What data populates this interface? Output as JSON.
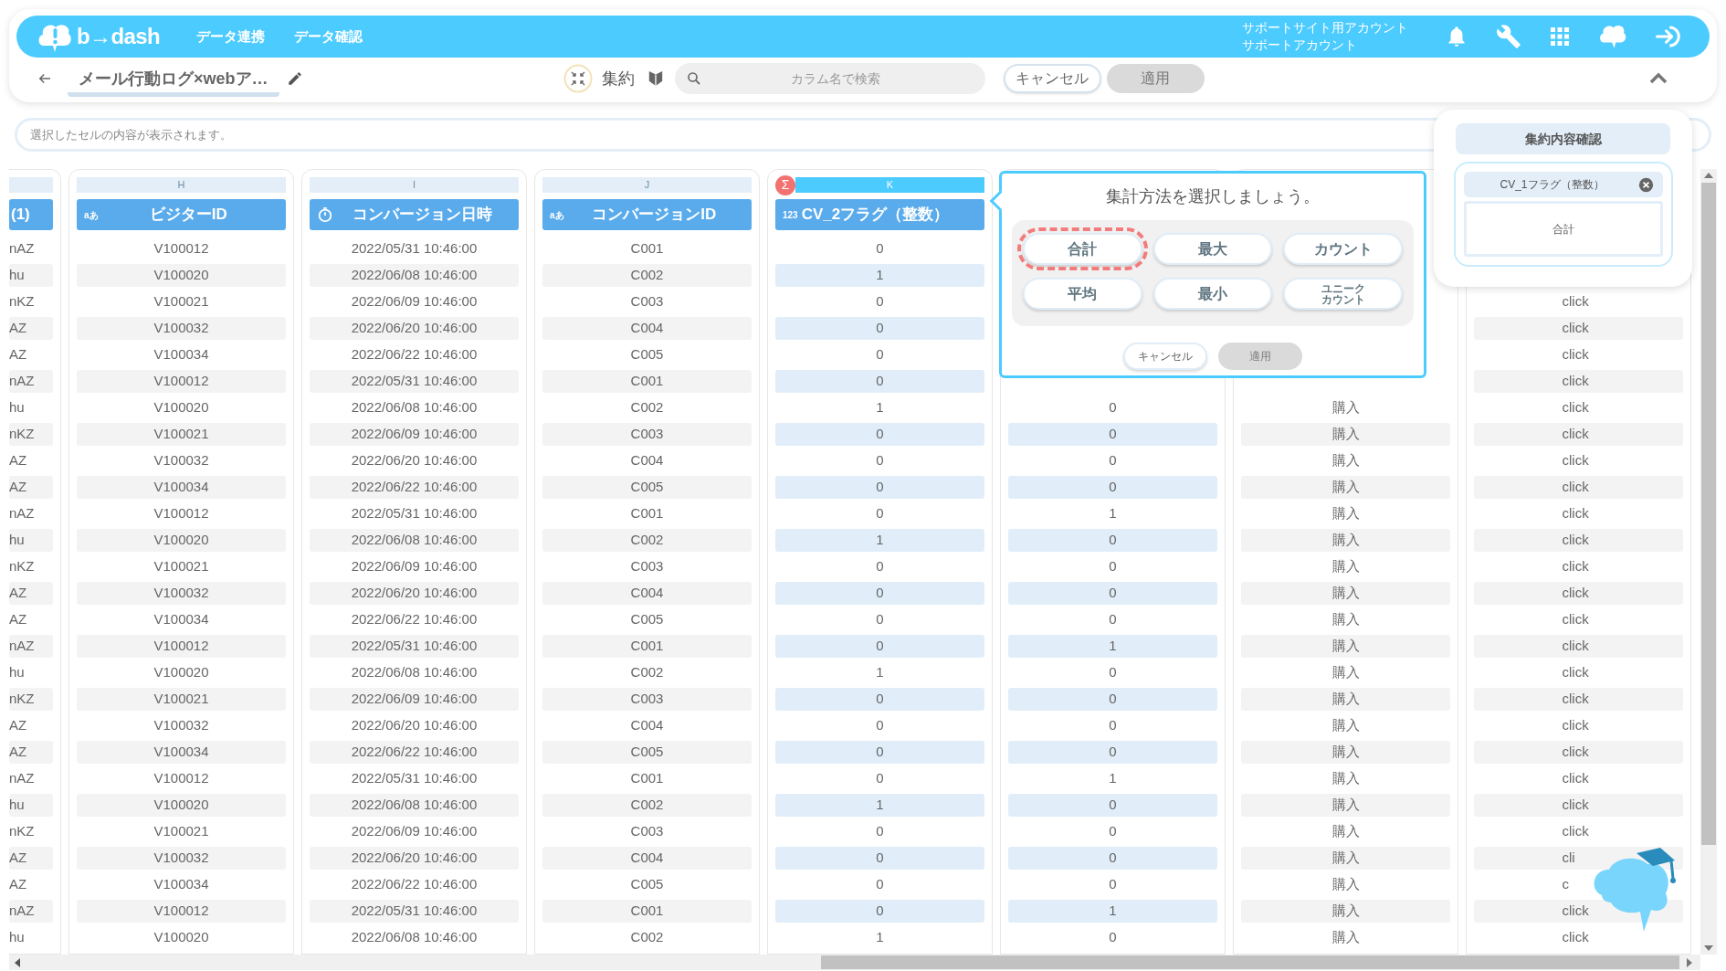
{
  "header": {
    "logo": "b→dash",
    "nav": [
      {
        "label": "データ連携"
      },
      {
        "label": "データ確認"
      }
    ],
    "account": [
      "サポートサイト用アカウント",
      "サポートアカウント"
    ]
  },
  "toolbar": {
    "title": "メール行動ログ×webア…",
    "mode_label": "集約",
    "search": {
      "placeholder": "カラム名で検索"
    },
    "buttons": [
      {
        "label": "キャンセル",
        "disabled": false
      },
      {
        "label": "適用",
        "disabled": true
      }
    ]
  },
  "cell_viewer": {
    "placeholder": "選択したセルの内容が表示されます。"
  },
  "columns": [
    {
      "title": "(1)",
      "kind": "plain",
      "selected": false,
      "aggregated": false,
      "cells": [
        "nAZ",
        "hu",
        "nKZ",
        "AZ",
        "AZ",
        "nAZ",
        "hu",
        "nKZ",
        "AZ",
        "AZ",
        "nAZ",
        "hu",
        "nKZ",
        "AZ",
        "AZ",
        "nAZ",
        "hu",
        "nKZ",
        "AZ",
        "AZ",
        "nAZ",
        "hu",
        "nKZ",
        "AZ",
        "AZ",
        "nAZ",
        "hu"
      ]
    },
    {
      "letter": "H",
      "title": "ビジターID",
      "kind": "text",
      "type_label": "aあ",
      "selected": false,
      "aggregated": false,
      "cells": [
        "V100012",
        "V100020",
        "V100021",
        "V100032",
        "V100034",
        "V100012",
        "V100020",
        "V100021",
        "V100032",
        "V100034",
        "V100012",
        "V100020",
        "V100021",
        "V100032",
        "V100034",
        "V100012",
        "V100020",
        "V100021",
        "V100032",
        "V100034",
        "V100012",
        "V100020",
        "V100021",
        "V100032",
        "V100034",
        "V100012",
        "V100020"
      ]
    },
    {
      "letter": "I",
      "title": "コンバージョン日時",
      "kind": "datetime",
      "selected": false,
      "aggregated": false,
      "cells": [
        "2022/05/31 10:46:00",
        "2022/06/08 10:46:00",
        "2022/06/09 10:46:00",
        "2022/06/20 10:46:00",
        "2022/06/22 10:46:00",
        "2022/05/31 10:46:00",
        "2022/06/08 10:46:00",
        "2022/06/09 10:46:00",
        "2022/06/20 10:46:00",
        "2022/06/22 10:46:00",
        "2022/05/31 10:46:00",
        "2022/06/08 10:46:00",
        "2022/06/09 10:46:00",
        "2022/06/20 10:46:00",
        "2022/06/22 10:46:00",
        "2022/05/31 10:46:00",
        "2022/06/08 10:46:00",
        "2022/06/09 10:46:00",
        "2022/06/20 10:46:00",
        "2022/06/22 10:46:00",
        "2022/05/31 10:46:00",
        "2022/06/08 10:46:00",
        "2022/06/09 10:46:00",
        "2022/06/20 10:46:00",
        "2022/06/22 10:46:00",
        "2022/05/31 10:46:00",
        "2022/06/08 10:46:00"
      ]
    },
    {
      "letter": "J",
      "title": "コンバージョンID",
      "kind": "text",
      "type_label": "aあ",
      "selected": false,
      "aggregated": false,
      "cells": [
        "C001",
        "C002",
        "C003",
        "C004",
        "C005",
        "C001",
        "C002",
        "C003",
        "C004",
        "C005",
        "C001",
        "C002",
        "C003",
        "C004",
        "C005",
        "C001",
        "C002",
        "C003",
        "C004",
        "C005",
        "C001",
        "C002",
        "C003",
        "C004",
        "C005",
        "C001",
        "C002"
      ]
    },
    {
      "letter": "K",
      "title": "CV_2フラグ（整数）",
      "kind": "number",
      "type_label": "123",
      "badge": "Σ",
      "selected": true,
      "aggregated": true,
      "cells": [
        "0",
        "1",
        "0",
        "0",
        "0",
        "0",
        "1",
        "0",
        "0",
        "0",
        "0",
        "1",
        "0",
        "0",
        "0",
        "0",
        "1",
        "0",
        "0",
        "0",
        "0",
        "1",
        "0",
        "0",
        "0",
        "0",
        "1"
      ]
    },
    {
      "aggregated": true,
      "cells": [
        "0",
        "0",
        "0",
        "0",
        "1",
        "0",
        "0",
        "0",
        "0",
        "1",
        "0",
        "0",
        "0",
        "0",
        "1",
        "0",
        "0",
        "0",
        "0",
        "1",
        "0"
      ]
    },
    {
      "aggregated": false,
      "cells": [
        "購入",
        "購入",
        "購入",
        "購入",
        "購入",
        "購入",
        "購入",
        "購入",
        "購入",
        "購入",
        "購入",
        "購入",
        "購入",
        "購入",
        "購入",
        "購入",
        "購入",
        "購入",
        "購入",
        "購入",
        "購入"
      ]
    },
    {
      "aggregated": false,
      "cells": [
        "click",
        "click",
        "click",
        "click",
        "click",
        "click",
        "click",
        "click",
        "click",
        "click",
        "click",
        "click",
        "click",
        "click",
        "click",
        "click",
        "click",
        "click",
        "click",
        "click",
        "click",
        "cli",
        "c",
        "click",
        "click"
      ]
    }
  ],
  "popup": {
    "title": "集計方法を選択しましょう。",
    "options": [
      {
        "label": "合計",
        "selected": true
      },
      {
        "label": "最大",
        "selected": false
      },
      {
        "label": "カウント",
        "selected": false
      },
      {
        "label": "平均",
        "selected": false
      },
      {
        "label": "最小",
        "selected": false
      },
      {
        "label": "ユニークカウント",
        "selected": false
      }
    ],
    "buttons": [
      {
        "label": "キャンセル",
        "disabled": false
      },
      {
        "label": "適用",
        "disabled": true
      }
    ]
  },
  "summary_panel": {
    "title": "集約内容確認",
    "column": "CV_1フラグ（整数）",
    "method": "合計"
  }
}
